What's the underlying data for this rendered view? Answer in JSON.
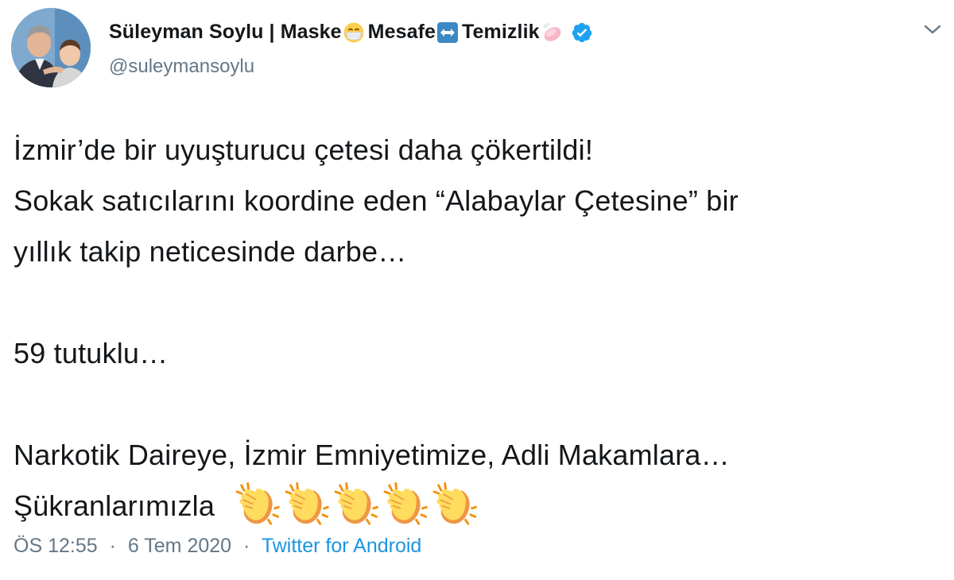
{
  "author": {
    "name_part1": "Süleyman Soylu | Maske",
    "name_part2": "Mesafe",
    "name_part3": "Temizlik",
    "handle": "@suleymansoylu",
    "emoji_1": "face-with-medical-mask-icon",
    "emoji_2": "left-right-arrow-icon",
    "emoji_3": "soap-icon",
    "verified_icon": "verified-badge-icon"
  },
  "tweet": {
    "lines": [
      "İzmir’de bir uyuşturucu çetesi daha çökertildi!",
      "Sokak satıcılarını koordine eden “Alabaylar Çetesine” bir",
      "yıllık takip neticesinde darbe…",
      "59 tutuklu…",
      "Narkotik Daireye, İzmir Emniyetimize, Adli Makamlara…",
      "Şükranlarımızla"
    ],
    "clap_icon": "clapping-hands-icon",
    "clap_count": 5
  },
  "meta": {
    "time": "ÖS 12:55",
    "separator": "·",
    "date": "6 Tem 2020",
    "source": "Twitter for Android"
  },
  "colors": {
    "text": "#14171a",
    "secondary": "#657786",
    "link": "#1b95e0",
    "verified": "#1da1f2"
  }
}
